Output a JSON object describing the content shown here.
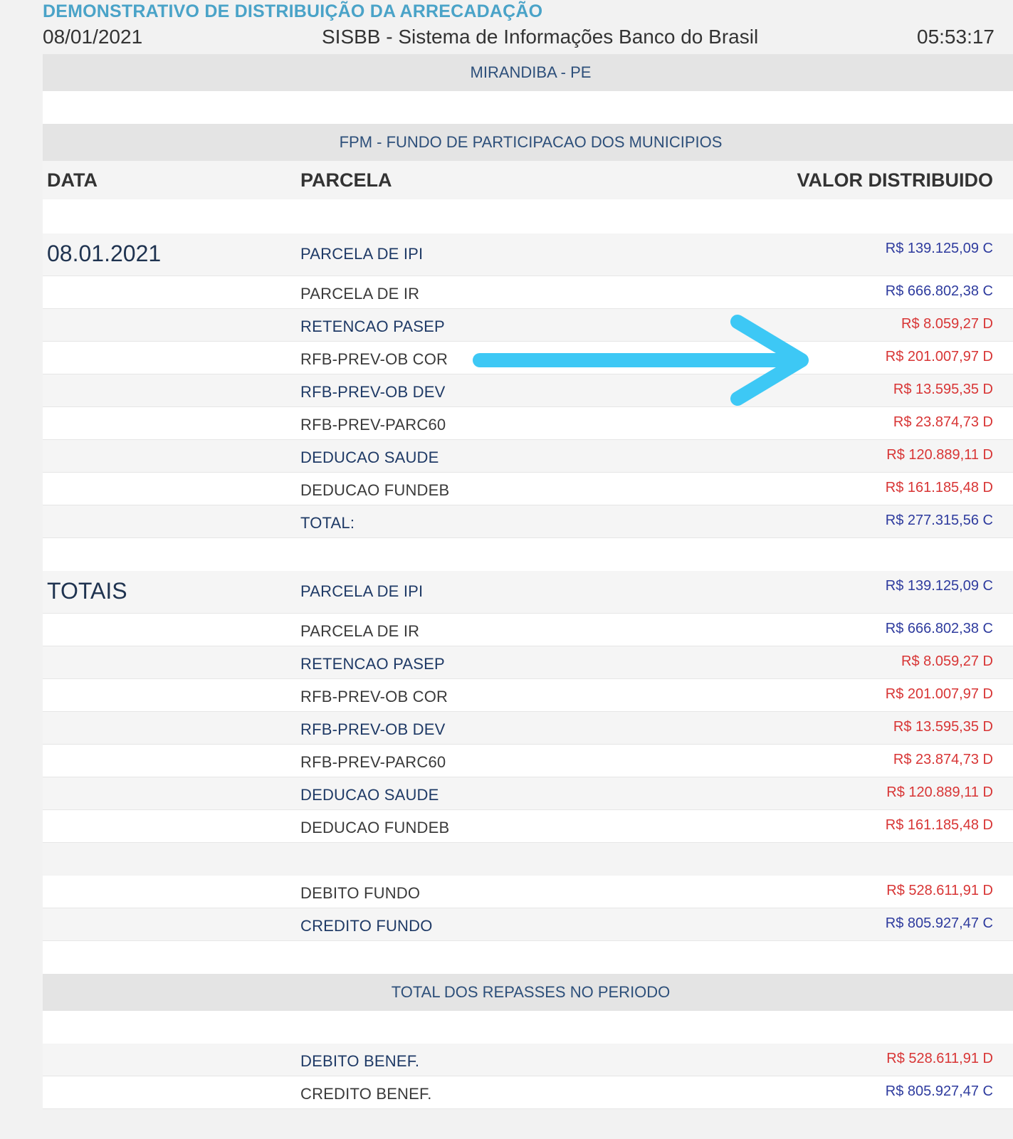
{
  "header": {
    "title": "DEMONSTRATIVO DE DISTRIBUIÇÃO DA ARRECADAÇÃO",
    "date": "08/01/2021",
    "system": "SISBB - Sistema de Informações Banco do Brasil",
    "time": "05:53:17"
  },
  "location": "MIRANDIBA - PE",
  "fund_title": "FPM - FUNDO DE PARTICIPACAO DOS MUNICIPIOS",
  "columns": {
    "data": "DATA",
    "parcela": "PARCELA",
    "valor": "VALOR DISTRIBUIDO"
  },
  "group1": {
    "label": "08.01.2021",
    "rows": [
      {
        "parcela": "PARCELA DE IPI",
        "valor": "R$ 139.125,09 C"
      },
      {
        "parcela": "PARCELA DE IR",
        "valor": "R$ 666.802,38 C"
      },
      {
        "parcela": "RETENCAO PASEP",
        "valor": "R$ 8.059,27 D"
      },
      {
        "parcela": "RFB-PREV-OB COR",
        "valor": "R$ 201.007,97 D"
      },
      {
        "parcela": "RFB-PREV-OB DEV",
        "valor": "R$ 13.595,35 D"
      },
      {
        "parcela": "RFB-PREV-PARC60",
        "valor": "R$ 23.874,73 D"
      },
      {
        "parcela": "DEDUCAO SAUDE",
        "valor": "R$ 120.889,11 D"
      },
      {
        "parcela": "DEDUCAO FUNDEB",
        "valor": "R$ 161.185,48 D"
      },
      {
        "parcela": "TOTAL:",
        "valor": "R$ 277.315,56 C"
      }
    ]
  },
  "group2": {
    "label": "TOTAIS",
    "rows": [
      {
        "parcela": "PARCELA DE IPI",
        "valor": "R$ 139.125,09 C"
      },
      {
        "parcela": "PARCELA DE IR",
        "valor": "R$ 666.802,38 C"
      },
      {
        "parcela": "RETENCAO PASEP",
        "valor": "R$ 8.059,27 D"
      },
      {
        "parcela": "RFB-PREV-OB COR",
        "valor": "R$ 201.007,97 D"
      },
      {
        "parcela": "RFB-PREV-OB DEV",
        "valor": "R$ 13.595,35 D"
      },
      {
        "parcela": "RFB-PREV-PARC60",
        "valor": "R$ 23.874,73 D"
      },
      {
        "parcela": "DEDUCAO SAUDE",
        "valor": "R$ 120.889,11 D"
      },
      {
        "parcela": "DEDUCAO FUNDEB",
        "valor": "R$ 161.185,48 D"
      }
    ]
  },
  "fund_totals": [
    {
      "parcela": "DEBITO FUNDO",
      "valor": "R$ 528.611,91 D"
    },
    {
      "parcela": "CREDITO FUNDO",
      "valor": "R$ 805.927,47 C"
    }
  ],
  "period_title": "TOTAL DOS REPASSES NO PERIODO",
  "period_rows": [
    {
      "parcela": "DEBITO BENEF.",
      "valor": "R$ 528.611,91 D"
    },
    {
      "parcela": "CREDITO BENEF.",
      "valor": "R$ 805.927,47 C"
    }
  ],
  "colors": {
    "title": "#4aa3c8",
    "credit": "#2e3b9e",
    "debit": "#d83535",
    "arrow": "#3dc8f5"
  },
  "annotation": {
    "icon": "arrow-right-icon"
  }
}
